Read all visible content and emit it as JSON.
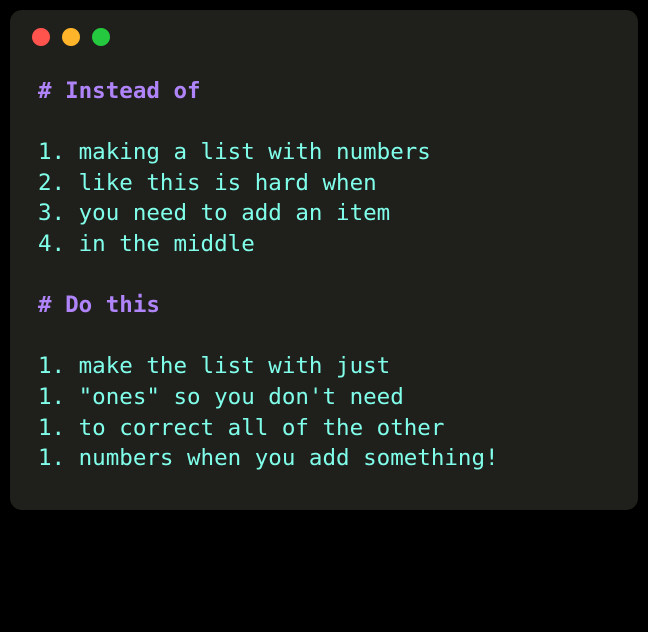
{
  "heading1": "# Instead of",
  "list1": [
    {
      "num": "1.",
      "text": "making a list with numbers"
    },
    {
      "num": "2.",
      "text": "like this is hard when"
    },
    {
      "num": "3.",
      "text": "you need to add an item"
    },
    {
      "num": "4.",
      "text": "in the middle"
    }
  ],
  "heading2": "# Do this",
  "list2": [
    {
      "num": "1.",
      "text": "make the list with just"
    },
    {
      "num": "1.",
      "text": "\"ones\" so you don't need"
    },
    {
      "num": "1.",
      "text": "to correct all of the other"
    },
    {
      "num": "1.",
      "text": "numbers when you add something!"
    }
  ]
}
